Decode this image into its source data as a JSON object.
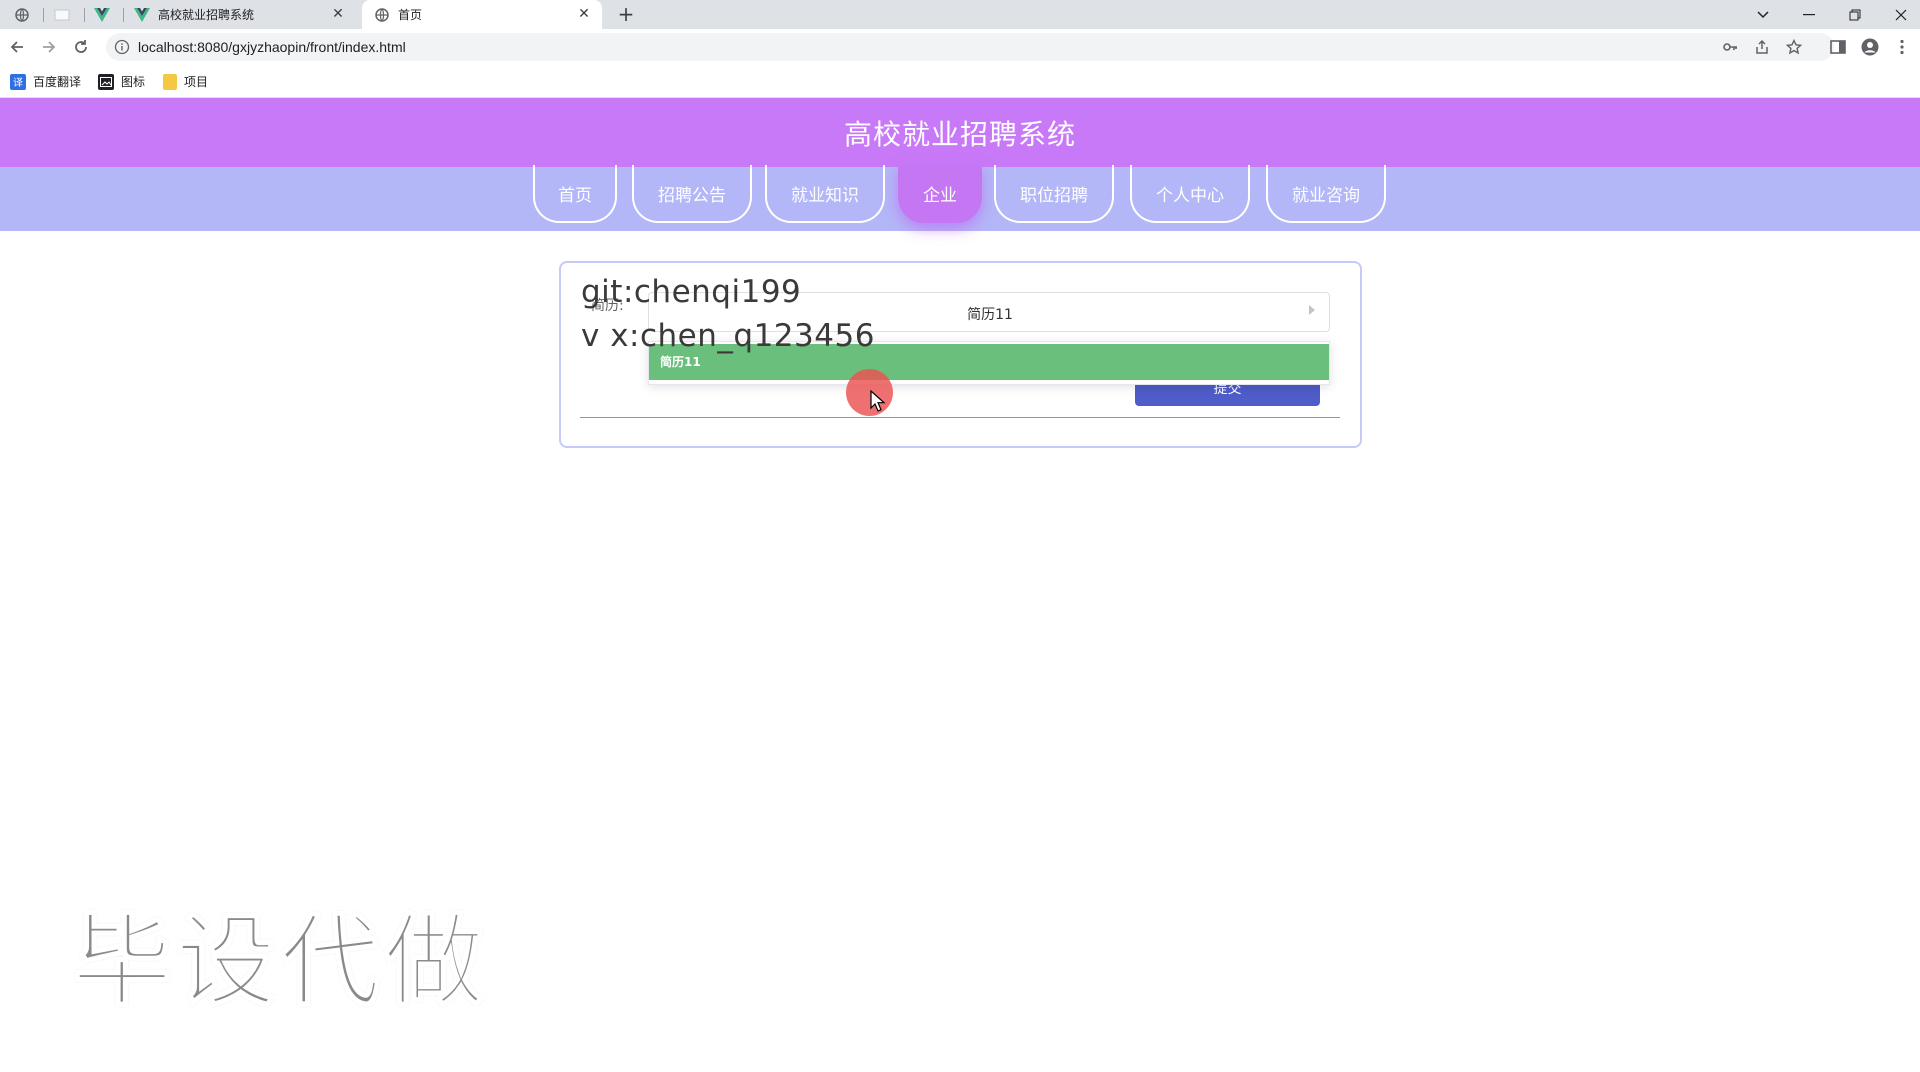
{
  "browser": {
    "tabs": [
      {
        "title": "",
        "icon": "globe-icon"
      },
      {
        "title": "",
        "icon": "blank-tab-icon"
      },
      {
        "title": "",
        "icon": "vue-logo-icon"
      },
      {
        "title": "高校就业招聘系统",
        "icon": "vue-logo-icon"
      },
      {
        "title": "首页",
        "icon": "globe-icon"
      }
    ],
    "new_tab": "+",
    "url": "localhost:8080/gxjyzhaopin/front/index.html",
    "bookmarks": [
      {
        "label": "百度翻译",
        "icon": "baidu-translate-icon",
        "color": "#2f6fe4"
      },
      {
        "label": "图标",
        "icon": "image-bookmark-icon",
        "color": "#202124"
      },
      {
        "label": "项目",
        "icon": "folder-icon",
        "color": "#f5c842"
      }
    ]
  },
  "header": {
    "title": "高校就业招聘系统",
    "bg_color": "#c879f7"
  },
  "nav": {
    "items": [
      "首页",
      "招聘公告",
      "就业知识",
      "企业",
      "职位招聘",
      "个人中心",
      "就业咨询"
    ],
    "active": "企业",
    "bg_color": "#b3b7f7"
  },
  "form": {
    "label": "简历:",
    "selected": "简历11",
    "dropdown_options": [
      "简历11"
    ],
    "submit_label": "提交"
  },
  "watermark": {
    "line1": "git:chenqi199",
    "line2": "v x:chen_q123456",
    "big": "毕设代做"
  }
}
